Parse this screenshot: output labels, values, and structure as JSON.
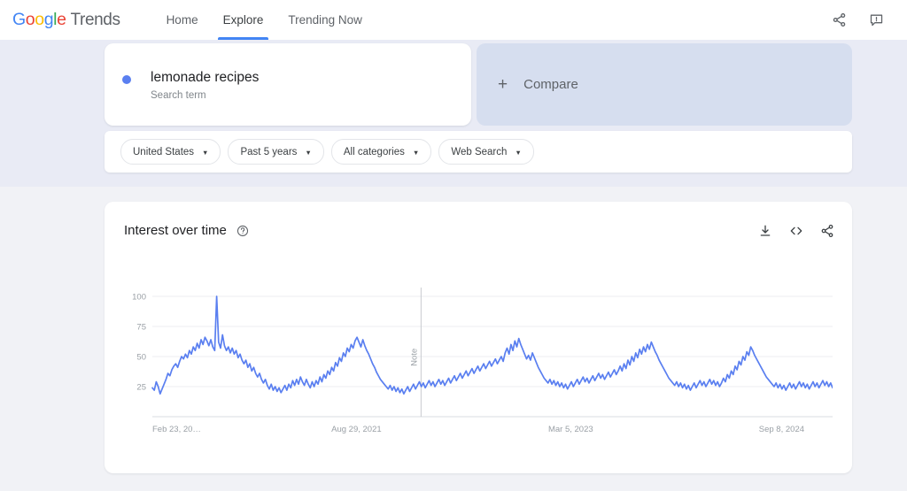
{
  "header": {
    "logo": {
      "g1": "G",
      "o1": "o",
      "o2": "o",
      "g2": "g",
      "l": "l",
      "e": "e",
      "word": "Trends"
    },
    "nav": [
      {
        "label": "Home",
        "active": false
      },
      {
        "label": "Explore",
        "active": true
      },
      {
        "label": "Trending Now",
        "active": false
      }
    ],
    "icons": [
      {
        "name": "share-icon",
        "title": "Share"
      },
      {
        "name": "feedback-icon",
        "title": "Send feedback"
      }
    ]
  },
  "search_term": {
    "title": "lemonade recipes",
    "subtitle": "Search term",
    "dot_color": "#5a7ff0"
  },
  "compare": {
    "plus": "+",
    "label": "Compare",
    "background": "#d6deef"
  },
  "filters": [
    {
      "label": "United States",
      "caret": "▼"
    },
    {
      "label": "Past 5 years",
      "caret": "▼"
    },
    {
      "label": "All categories",
      "caret": "▼"
    },
    {
      "label": "Web Search",
      "caret": "▼"
    }
  ],
  "chart_card": {
    "title": "Interest over time",
    "help_icon": "help-circle-icon",
    "tools": [
      {
        "name": "download-icon",
        "title": "Download CSV"
      },
      {
        "name": "embed-code-icon",
        "title": "Embed"
      },
      {
        "name": "share-icon",
        "title": "Share"
      }
    ]
  },
  "chart_data": {
    "type": "line",
    "title": "Interest over time",
    "xlabel": "",
    "ylabel": "",
    "ylim": [
      0,
      100
    ],
    "grid": true,
    "legend": false,
    "line_color": "#5a7ff0",
    "y_ticks": [
      100,
      75,
      50,
      25
    ],
    "x_ticks": [
      "Feb 23, 20…",
      "Aug 29, 2021",
      "Mar 5, 2023",
      "Sep 8, 2024"
    ],
    "x_tick_positions": [
      0,
      0.3,
      0.615,
      0.925
    ],
    "annotations": [
      {
        "label": "Note",
        "x_fraction": 0.395,
        "type": "vertical-line"
      }
    ],
    "series": [
      {
        "name": "lemonade recipes",
        "values": [
          24,
          22,
          29,
          25,
          19,
          23,
          27,
          31,
          36,
          34,
          39,
          42,
          44,
          41,
          46,
          50,
          48,
          52,
          49,
          55,
          52,
          58,
          55,
          61,
          57,
          64,
          60,
          66,
          63,
          59,
          64,
          58,
          55,
          100,
          62,
          57,
          68,
          59,
          55,
          58,
          53,
          57,
          52,
          55,
          49,
          52,
          47,
          44,
          47,
          41,
          44,
          38,
          41,
          36,
          33,
          36,
          31,
          28,
          31,
          26,
          23,
          27,
          22,
          25,
          21,
          24,
          20,
          23,
          26,
          22,
          27,
          24,
          30,
          26,
          31,
          27,
          33,
          29,
          26,
          31,
          27,
          24,
          29,
          25,
          30,
          27,
          33,
          29,
          35,
          32,
          38,
          35,
          41,
          38,
          45,
          42,
          49,
          46,
          53,
          50,
          57,
          54,
          60,
          57,
          63,
          66,
          62,
          58,
          64,
          59,
          55,
          52,
          48,
          44,
          41,
          37,
          34,
          31,
          29,
          27,
          25,
          23,
          26,
          22,
          25,
          21,
          24,
          20,
          23,
          19,
          22,
          25,
          21,
          24,
          27,
          23,
          26,
          29,
          25,
          28,
          24,
          27,
          30,
          26,
          29,
          25,
          28,
          31,
          27,
          30,
          26,
          29,
          32,
          28,
          31,
          34,
          30,
          33,
          36,
          32,
          35,
          38,
          34,
          37,
          40,
          36,
          39,
          42,
          38,
          41,
          44,
          40,
          43,
          46,
          42,
          45,
          48,
          44,
          47,
          50,
          46,
          53,
          57,
          52,
          60,
          55,
          63,
          58,
          65,
          60,
          56,
          52,
          48,
          51,
          47,
          53,
          49,
          45,
          41,
          38,
          35,
          32,
          30,
          28,
          31,
          27,
          30,
          26,
          29,
          25,
          28,
          24,
          27,
          23,
          26,
          29,
          25,
          28,
          31,
          27,
          30,
          33,
          29,
          32,
          28,
          31,
          34,
          30,
          33,
          36,
          32,
          35,
          31,
          34,
          37,
          33,
          36,
          39,
          35,
          38,
          42,
          38,
          44,
          40,
          47,
          43,
          50,
          46,
          53,
          49,
          56,
          52,
          58,
          54,
          60,
          56,
          62,
          58,
          54,
          51,
          47,
          44,
          41,
          38,
          35,
          32,
          30,
          28,
          26,
          29,
          25,
          28,
          24,
          27,
          23,
          26,
          22,
          25,
          28,
          24,
          27,
          30,
          26,
          29,
          25,
          28,
          31,
          27,
          30,
          26,
          29,
          25,
          28,
          32,
          29,
          35,
          32,
          38,
          35,
          42,
          39,
          46,
          43,
          50,
          47,
          54,
          51,
          58,
          55,
          51,
          48,
          45,
          42,
          39,
          36,
          33,
          31,
          29,
          27,
          25,
          28,
          24,
          27,
          23,
          26,
          22,
          25,
          28,
          24,
          27,
          23,
          26,
          29,
          25,
          28,
          24,
          27,
          23,
          26,
          29,
          25,
          28,
          24,
          27,
          30,
          26,
          29,
          25,
          28,
          24
        ]
      }
    ]
  }
}
